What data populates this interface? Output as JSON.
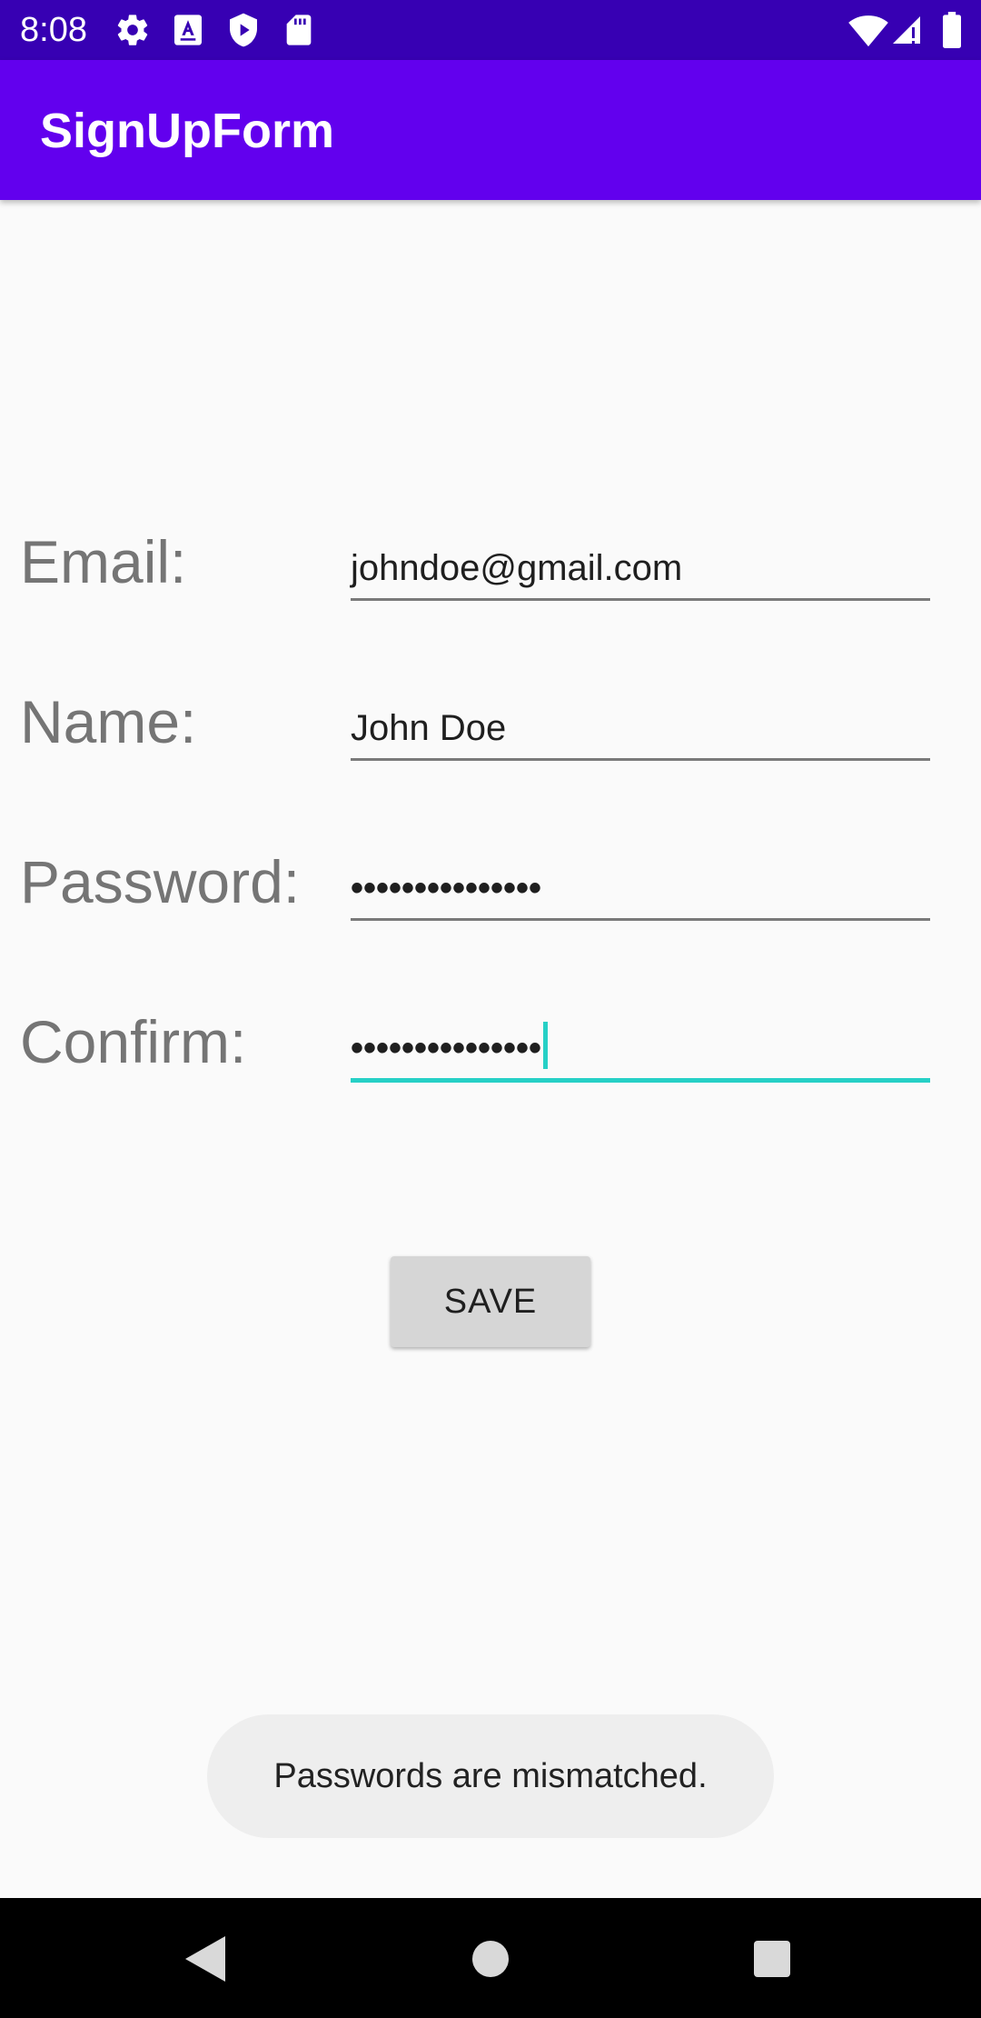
{
  "status_bar": {
    "time": "8:08",
    "left_icons": [
      "gear-icon",
      "keyboard-a-icon",
      "shield-icon",
      "sd-card-icon"
    ],
    "right_icons": [
      "wifi-icon",
      "cellular-signal-icon",
      "battery-icon"
    ]
  },
  "app_bar": {
    "title": "SignUpForm",
    "color": "#6200ee"
  },
  "form": {
    "email": {
      "label": "Email:",
      "value": "johndoe@gmail.com"
    },
    "name": {
      "label": "Name:",
      "value": "John Doe"
    },
    "password": {
      "label": "Password:",
      "value": "•••••••••••••••"
    },
    "confirm": {
      "label": "Confirm:",
      "value": "•••••••••••••••",
      "focused": true
    }
  },
  "save_button": {
    "label": "SAVE"
  },
  "toast": {
    "message": "Passwords are mismatched."
  },
  "nav_bar": {
    "icons": [
      "back-icon",
      "home-icon",
      "recents-icon"
    ]
  },
  "colors": {
    "status_bar": "#3700b3",
    "accent": "#26d0c6",
    "background": "#fafafa"
  }
}
